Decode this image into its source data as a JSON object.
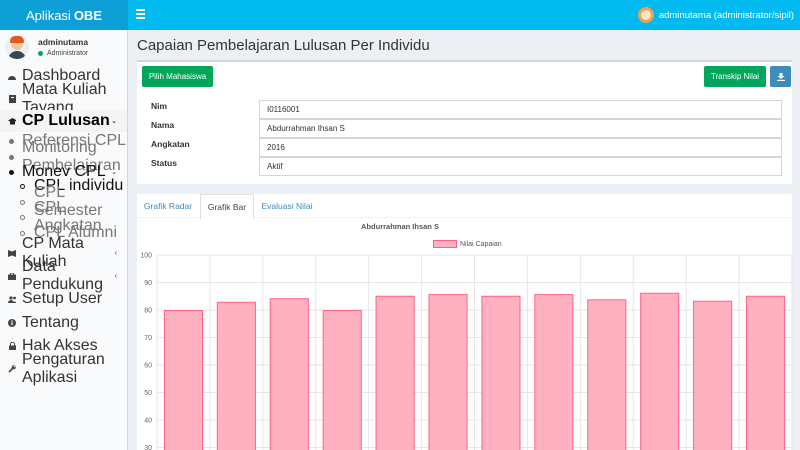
{
  "app": {
    "title_regular": "Aplikasi",
    "title_bold": "OBE"
  },
  "topbar": {
    "user_label": "adminutama (administrator/sipil)"
  },
  "sidebar": {
    "user": {
      "name": "adminutama",
      "role": "Administrator"
    },
    "items": [
      {
        "label": "Dashboard",
        "icon": "dashboard-icon"
      },
      {
        "label": "Mata Kuliah Tayang",
        "icon": "book-icon"
      },
      {
        "label": "CP Lulusan",
        "icon": "graduation-cap-icon",
        "arrow": "⌄"
      },
      {
        "label": "Referensi CPL"
      },
      {
        "label": "Monitoring Pembelajaran"
      },
      {
        "label": "Monev CPL",
        "arrow": "⌄"
      },
      {
        "label": "CPL individu"
      },
      {
        "label": "CPL Semester"
      },
      {
        "label": "CPL Angkatan"
      },
      {
        "label": "CPL Alumni"
      },
      {
        "label": "CP Mata Kuliah",
        "icon": "book-icon",
        "arrow": "‹"
      },
      {
        "label": "Data Pendukung",
        "icon": "briefcase-icon",
        "arrow": "‹"
      },
      {
        "label": "Setup User",
        "icon": "users-icon"
      },
      {
        "label": "Tentang",
        "icon": "info-icon"
      },
      {
        "label": "Hak Akses",
        "icon": "lock-icon"
      },
      {
        "label": "Pengaturan Aplikasi",
        "icon": "wrench-icon"
      }
    ]
  },
  "main": {
    "page_title": "Capaian Pembelajaran Lulusan Per Individu",
    "pilih_button": "Pilih Mahasiswa",
    "transkip_button": "Transkip Nilai",
    "fields": [
      {
        "label": "Nim",
        "value": "I0116001"
      },
      {
        "label": "Nama",
        "value": "Abdurrahman Ihsan S"
      },
      {
        "label": "Angkatan",
        "value": "2016"
      },
      {
        "label": "Status",
        "value": "Aktif"
      }
    ],
    "tabs": [
      "Grafik Radar",
      "Grafik Bar",
      "Evaluasi Nilai"
    ],
    "active_tab": "Grafik Bar"
  },
  "colors": {
    "accent": "#00baf0",
    "logo": "#0d9fd6",
    "green": "#00a65a",
    "blue": "#3c8dbc",
    "bar_fill": "#ffb1c1",
    "bar_stroke": "#ff6384"
  },
  "chart_data": {
    "type": "bar",
    "title": "Abdurrahman Ihsan S",
    "ylim": [
      30,
      100
    ],
    "yticks": [
      30,
      40,
      50,
      60,
      70,
      80,
      90,
      100
    ],
    "grid": true,
    "legend": "top-center",
    "series": [
      {
        "name": "Nilai Capaian",
        "values": [
          79.8,
          82.8,
          84.1,
          79.8,
          85.0,
          85.6,
          85.0,
          85.6,
          83.7,
          86.1,
          83.2,
          85.0
        ]
      }
    ]
  }
}
